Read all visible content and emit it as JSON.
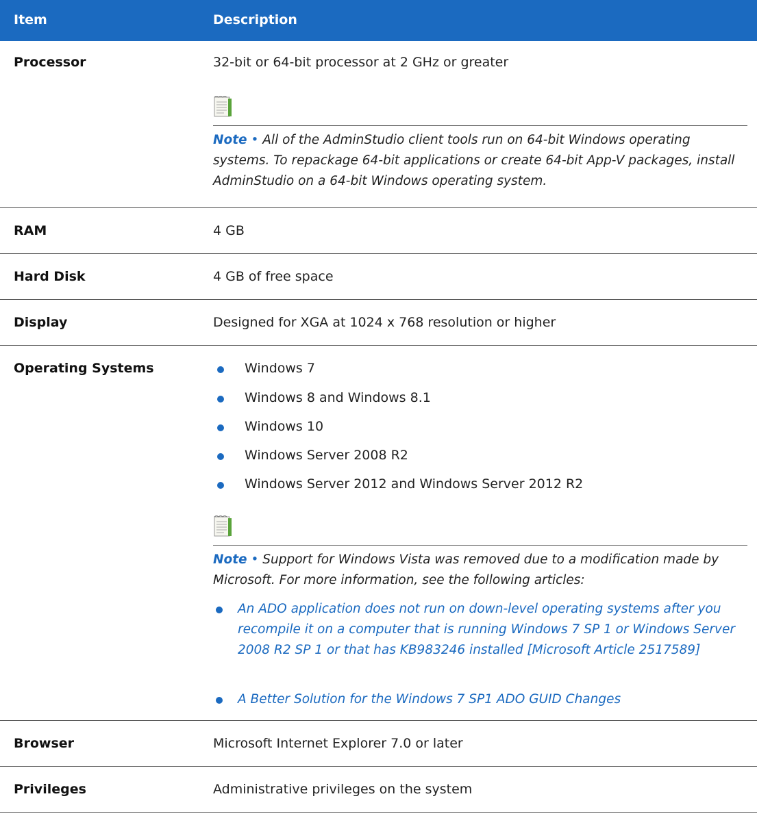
{
  "header": {
    "col1": "Item",
    "col2": "Description"
  },
  "rows": {
    "processor": {
      "label": "Processor",
      "value": "32-bit or 64-bit processor at 2 GHz or greater",
      "note_label": "Note",
      "note_sep": " • ",
      "note_text": "All of the AdminStudio client tools run on 64-bit Windows operating systems. To repackage 64-bit applications or create 64-bit App-V packages, install AdminStudio on a 64-bit Windows operating system."
    },
    "ram": {
      "label": "RAM",
      "value": "4 GB"
    },
    "hard_disk": {
      "label": "Hard Disk",
      "value": "4 GB of free space"
    },
    "display": {
      "label": "Display",
      "value": "Designed for XGA at 1024 x 768 resolution or higher"
    },
    "os": {
      "label": "Operating Systems",
      "items": [
        "Windows 7",
        "Windows 8 and Windows 8.1",
        "Windows 10",
        "Windows Server 2008 R2",
        "Windows Server 2012 and Windows Server 2012 R2"
      ],
      "note_label": "Note",
      "note_sep": " • ",
      "note_text": "Support for Windows Vista was removed due to a modification made by Microsoft. For more information, see the following articles:",
      "links": [
        "An ADO application does not run on down-level operating systems after you recompile it on a computer that is running Windows 7 SP 1 or Windows Server 2008 R2 SP 1 or that has KB983246 installed [Microsoft Article 2517589]",
        "A Better Solution for the Windows 7 SP1 ADO GUID Changes"
      ]
    },
    "browser": {
      "label": "Browser",
      "value": "Microsoft Internet Explorer 7.0 or later"
    },
    "privileges": {
      "label": "Privileges",
      "value": "Administrative privileges on the system"
    }
  },
  "colors": {
    "accent": "#1b6ac0",
    "header_text": "#ffffff",
    "rule": "#5a5a5a"
  },
  "icons": {
    "note": "notepad-icon",
    "bullet": "bullet-dot"
  }
}
